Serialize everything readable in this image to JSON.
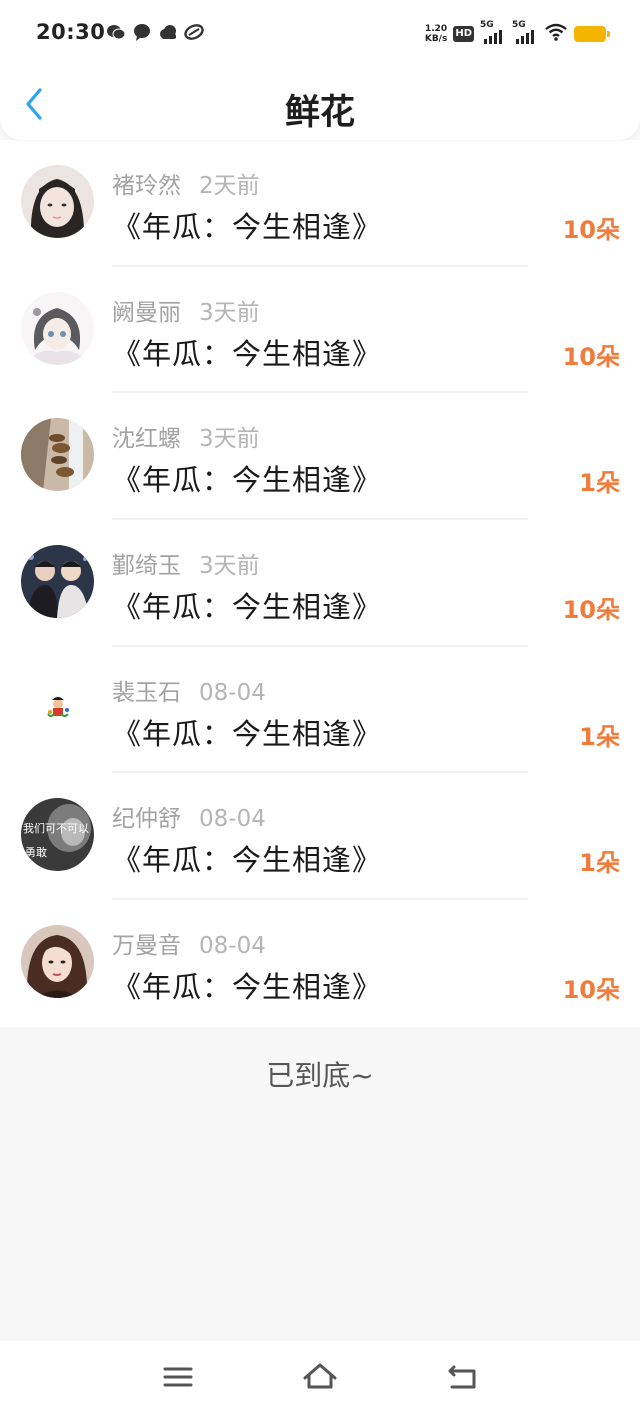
{
  "status_bar": {
    "time": "20:30",
    "net_speed_value": "1.20",
    "net_speed_unit": "KB/s",
    "hd": "HD",
    "sim1": "5G",
    "sim2": "5G",
    "icons": [
      "wechat-icon",
      "message-icon",
      "cloud-icon",
      "app-icon",
      "wifi-icon",
      "battery-icon"
    ]
  },
  "header": {
    "title": "鲜花",
    "back_icon": "chevron-left-icon",
    "accent_color": "#2aa3f0"
  },
  "list": {
    "count_color": "#f07b3a",
    "items": [
      {
        "name": "褚玲然",
        "time": "2天前",
        "book": "《年瓜：今生相逢》",
        "count": "10朵"
      },
      {
        "name": "阙曼丽",
        "time": "3天前",
        "book": "《年瓜：今生相逢》",
        "count": "10朵"
      },
      {
        "name": "沈红螺",
        "time": "3天前",
        "book": "《年瓜：今生相逢》",
        "count": "1朵"
      },
      {
        "name": "鄞绮玉",
        "time": "3天前",
        "book": "《年瓜：今生相逢》",
        "count": "10朵"
      },
      {
        "name": "裴玉石",
        "time": "08-04",
        "book": "《年瓜：今生相逢》",
        "count": "1朵"
      },
      {
        "name": "纪仲舒",
        "time": "08-04",
        "book": "《年瓜：今生相逢》",
        "count": "1朵"
      },
      {
        "name": "万曼音",
        "time": "08-04",
        "book": "《年瓜：今生相逢》",
        "count": "10朵"
      }
    ]
  },
  "footer": {
    "end_text": "已到底~"
  },
  "avatar_text": "我们可不可以 勇敢",
  "nav_bar": {
    "icons": [
      "menu-icon",
      "home-icon",
      "back-icon"
    ]
  }
}
